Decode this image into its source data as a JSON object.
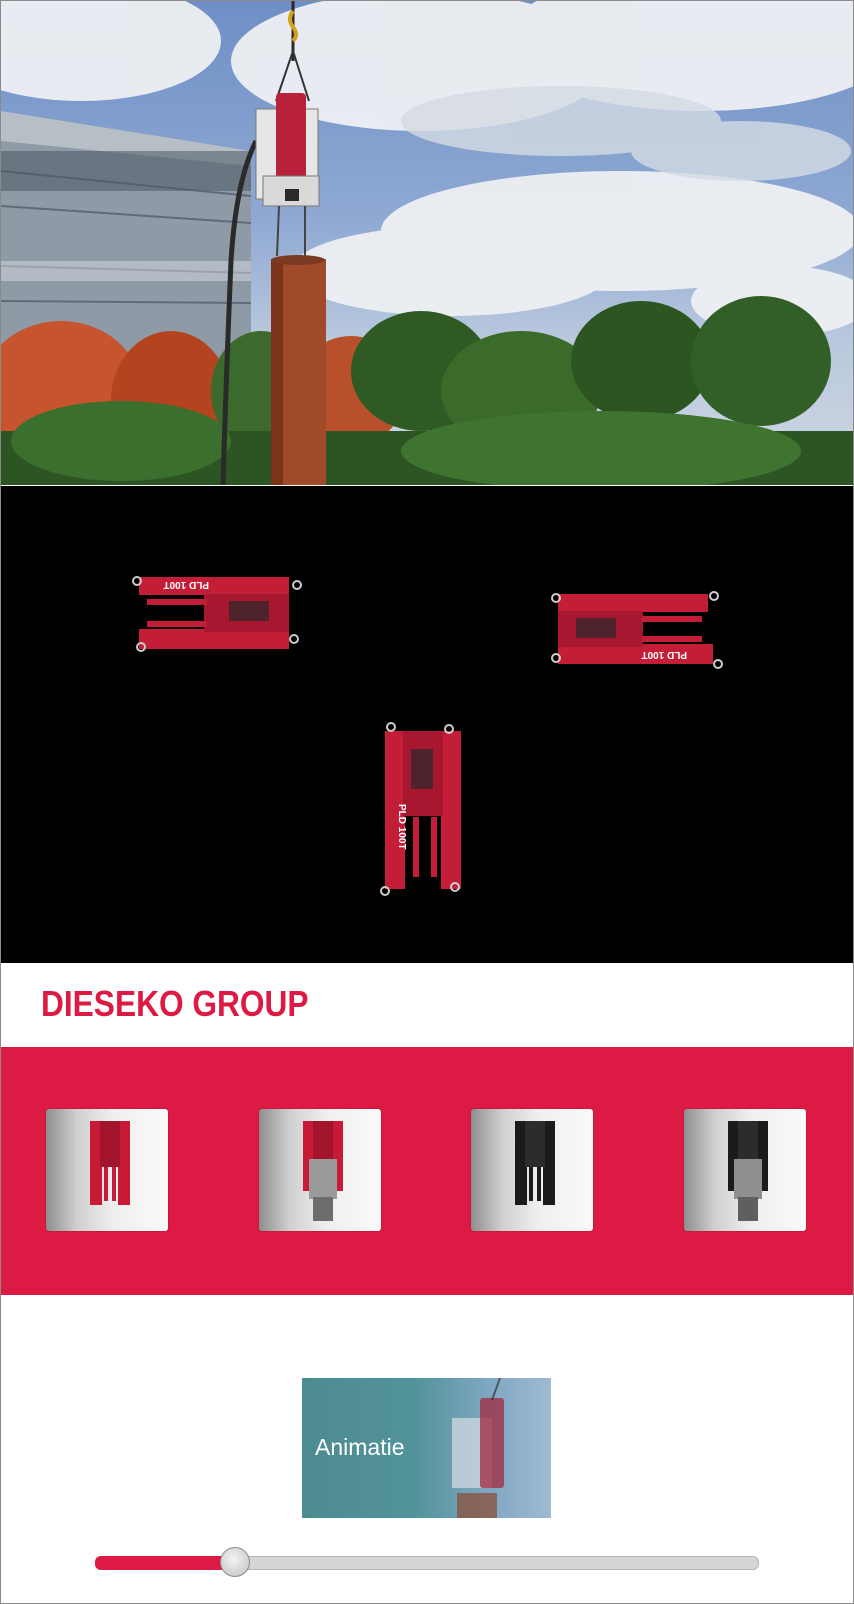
{
  "brand": {
    "name": "DIESEKO GROUP",
    "color": "#dc1a44"
  },
  "viewer": {
    "hammers": [
      {
        "label": "PLD 100T",
        "view": "top-left"
      },
      {
        "label": "PLD 100T",
        "view": "top-right"
      },
      {
        "label": "PLD 100T",
        "view": "front"
      }
    ]
  },
  "thumbnails": [
    {
      "icon": "red-frame-icon",
      "color": "#c81a36"
    },
    {
      "icon": "red-frame-with-hammer-icon",
      "color": "#c81a36"
    },
    {
      "icon": "black-frame-icon",
      "color": "#1b1b1b"
    },
    {
      "icon": "black-frame-with-hammer-icon",
      "color": "#1b1b1b"
    }
  ],
  "animation": {
    "label": "Animatie"
  },
  "slider": {
    "value_fraction": 0.21
  }
}
